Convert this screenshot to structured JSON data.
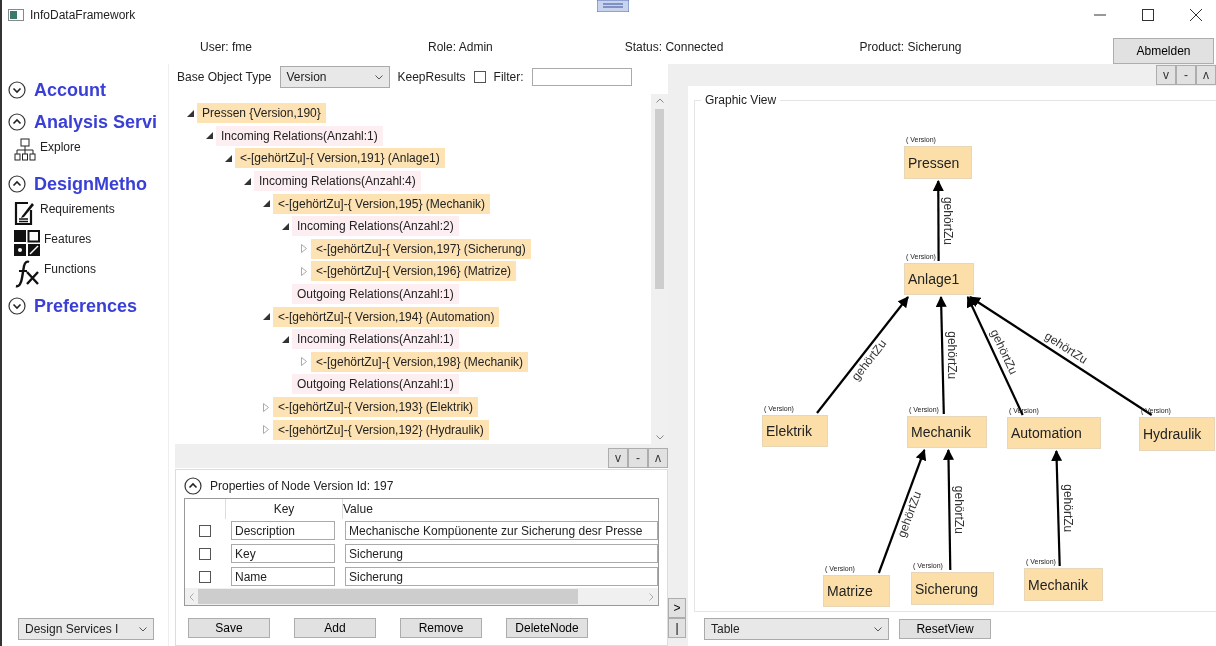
{
  "window": {
    "title": "InfoDataFramework"
  },
  "header": {
    "user": "User: fme",
    "role": "Role: Admin",
    "status": "Status: Connected",
    "product": "Product: Sicherung",
    "logout": "Abmelden"
  },
  "sidebar": {
    "sections": [
      {
        "title": "Account",
        "expanded": false
      },
      {
        "title": "Analysis Servi",
        "expanded": true,
        "items": [
          {
            "label": "Explore"
          }
        ]
      },
      {
        "title": "DesignMetho",
        "expanded": true,
        "items": [
          {
            "label": "Requirements"
          },
          {
            "label": "Features"
          },
          {
            "label": "Functions"
          }
        ]
      },
      {
        "title": "Preferences",
        "expanded": false
      }
    ],
    "service_select": "Design Services I"
  },
  "query": {
    "base_label": "Base Object Type",
    "base_value": "Version",
    "keep_label": "KeepResults",
    "keep_checked": false,
    "filter_label": "Filter:"
  },
  "tree": [
    {
      "label": "Pressen {Version,190}",
      "kind": "node",
      "expanded": true,
      "children": [
        {
          "label": "Incoming Relations(Anzahl:1)",
          "kind": "incoming",
          "expanded": true,
          "children": [
            {
              "label": "<-[gehörtZu]-{ Version,191} (Anlage1)",
              "kind": "node",
              "expanded": true,
              "children": [
                {
                  "label": "Incoming Relations(Anzahl:4)",
                  "kind": "incoming",
                  "expanded": true,
                  "children": [
                    {
                      "label": "<-[gehörtZu]-{ Version,195} (Mechanik)",
                      "kind": "node",
                      "expanded": true,
                      "children": [
                        {
                          "label": "Incoming Relations(Anzahl:2)",
                          "kind": "incoming",
                          "expanded": true,
                          "children": [
                            {
                              "label": "<-[gehörtZu]-{ Version,197} (Sicherung)",
                              "kind": "node",
                              "expanded": false
                            },
                            {
                              "label": "<-[gehörtZu]-{ Version,196} (Matrize)",
                              "kind": "node",
                              "expanded": false
                            }
                          ]
                        },
                        {
                          "label": "Outgoing Relations(Anzahl:1)",
                          "kind": "outgoing"
                        }
                      ]
                    },
                    {
                      "label": "<-[gehörtZu]-{ Version,194} (Automation)",
                      "kind": "node",
                      "expanded": true,
                      "children": [
                        {
                          "label": "Incoming Relations(Anzahl:1)",
                          "kind": "incoming",
                          "expanded": true,
                          "children": [
                            {
                              "label": "<-[gehörtZu]-{ Version,198} (Mechanik)",
                              "kind": "node",
                              "expanded": false
                            }
                          ]
                        },
                        {
                          "label": "Outgoing Relations(Anzahl:1)",
                          "kind": "outgoing"
                        }
                      ]
                    },
                    {
                      "label": "<-[gehörtZu]-{ Version,193} (Elektrik)",
                      "kind": "node",
                      "expanded": false
                    },
                    {
                      "label": "<-[gehörtZu]-{ Version,192} (Hydraulik)",
                      "kind": "node",
                      "expanded": false
                    }
                  ]
                }
              ]
            }
          ]
        }
      ]
    }
  ],
  "splitter_buttons": [
    "v",
    "-",
    "ʌ"
  ],
  "side_buttons": [
    ">",
    "|"
  ],
  "right_buttons": [
    "v",
    "-",
    "ʌ"
  ],
  "properties": {
    "title": "Properties of Node Version Id: 197",
    "expanded": true,
    "columns": [
      "Key",
      "Value"
    ],
    "rows": [
      {
        "checked": false,
        "key": "Description",
        "value": "Mechanische Kompüonente zur Sicherung desr Presse"
      },
      {
        "checked": false,
        "key": "Key",
        "value": "Sicherung"
      },
      {
        "checked": false,
        "key": "Name",
        "value": "Sicherung"
      }
    ],
    "buttons": [
      "Save",
      "Add",
      "Remove",
      "DeleteNode"
    ]
  },
  "graph": {
    "title": "Graphic View",
    "nodes": [
      {
        "type": "( Version)",
        "label": "Pressen"
      },
      {
        "type": "( Version)",
        "label": "Anlage1"
      },
      {
        "type": "( Version)",
        "label": "Elektrik"
      },
      {
        "type": "( Version)",
        "label": "Mechanik"
      },
      {
        "type": "( Version)",
        "label": "Automation"
      },
      {
        "type": "( Version)",
        "label": "Hydraulik"
      },
      {
        "type": "( Version)",
        "label": "Matrize"
      },
      {
        "type": "( Version)",
        "label": "Sicherung"
      },
      {
        "type": "( Version)",
        "label": "Mechanik"
      }
    ],
    "edges": [
      {
        "label": "gehörtZu"
      },
      {
        "label": "gehörtZu"
      },
      {
        "label": "gehörtZu"
      },
      {
        "label": "gehörtZu"
      },
      {
        "label": "gehörtZu"
      },
      {
        "label": "gehörtZu"
      },
      {
        "label": "gehörtZu"
      },
      {
        "label": "gehörtZu"
      }
    ],
    "view_select": "Table",
    "reset": "ResetView"
  }
}
